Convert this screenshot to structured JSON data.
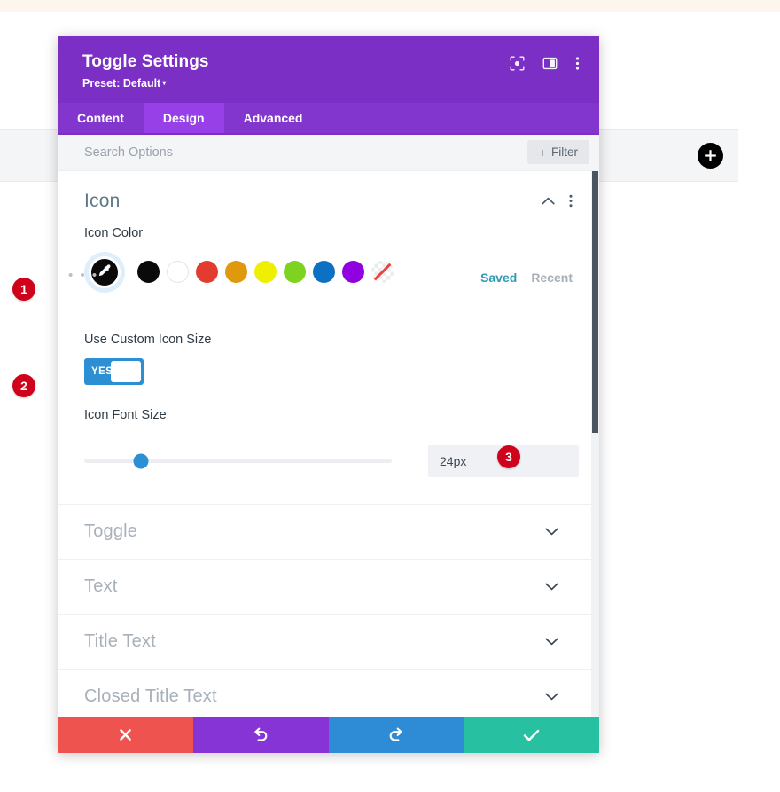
{
  "background": {
    "add_button_icon": "plus-icon"
  },
  "modal": {
    "title": "Toggle Settings",
    "preset_label": "Preset: Default",
    "preset_caret": "▾",
    "header_icons": [
      {
        "name": "focus-target-icon"
      },
      {
        "name": "layout-panel-icon"
      },
      {
        "name": "vertical-dots-icon"
      }
    ],
    "tabs": [
      {
        "label": "Content",
        "active": false
      },
      {
        "label": "Design",
        "active": true
      },
      {
        "label": "Advanced",
        "active": false
      }
    ],
    "search": {
      "value": "",
      "placeholder": "Search Options",
      "filter_label": "Filter",
      "filter_plus": "+"
    },
    "icon_section": {
      "title": "Icon",
      "expanded": true,
      "color_field": {
        "label": "Icon Color",
        "eyedropper_icon": "eyedropper-icon",
        "more_dots": "• • •",
        "swatches": [
          {
            "name": "swatch-black",
            "color": "#0a0a0a"
          },
          {
            "name": "swatch-white",
            "color": "#ffffff"
          },
          {
            "name": "swatch-red",
            "color": "#e33b30"
          },
          {
            "name": "swatch-orange",
            "color": "#e0980c"
          },
          {
            "name": "swatch-yellow",
            "color": "#eff000"
          },
          {
            "name": "swatch-green",
            "color": "#7ed321"
          },
          {
            "name": "swatch-blue",
            "color": "#0c71c3"
          },
          {
            "name": "swatch-purple",
            "color": "#9000e0"
          },
          {
            "name": "swatch-transparent",
            "color": "transparent"
          }
        ],
        "saved_label": "Saved",
        "recent_label": "Recent"
      },
      "custom_size_toggle": {
        "label": "Use Custom Icon Size",
        "value": "YES"
      },
      "font_size": {
        "label": "Icon Font Size",
        "value": "24px",
        "slider_percent": 18
      }
    },
    "collapsed_sections": [
      {
        "title": "Toggle"
      },
      {
        "title": "Text"
      },
      {
        "title": "Title Text"
      },
      {
        "title": "Closed Title Text"
      }
    ],
    "footer_buttons": [
      {
        "name": "cancel-button",
        "icon": "close-x-icon",
        "glyph": "✖"
      },
      {
        "name": "undo-button",
        "icon": "undo-icon",
        "glyph": "↺"
      },
      {
        "name": "redo-button",
        "icon": "redo-icon",
        "glyph": "↻"
      },
      {
        "name": "save-button",
        "icon": "checkmark-icon",
        "glyph": "✔"
      }
    ]
  },
  "annotation_badges": [
    {
      "number": "1"
    },
    {
      "number": "2"
    },
    {
      "number": "3"
    }
  ]
}
